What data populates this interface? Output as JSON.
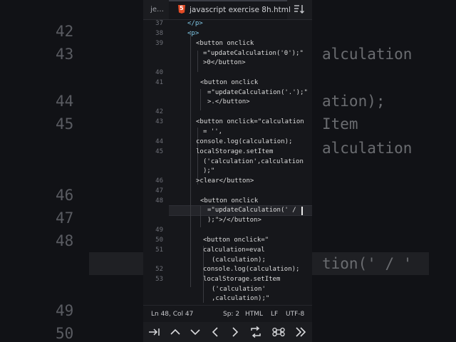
{
  "background": {
    "left_lines": [
      "42",
      "43",
      "44",
      "45",
      "46",
      "47",
      "48",
      "49",
      "50"
    ],
    "right_lines": [
      "alculation",
      "ation);",
      "Item",
      "alculation",
      "tion(' / '"
    ]
  },
  "tabs": {
    "previous_label": "je…",
    "active_label": "javascript exercise 8h.html",
    "file_icon": "html5-icon",
    "sort_icon": "sort-icon"
  },
  "editor": {
    "line_numbers": [
      "37",
      "38",
      "39",
      "",
      "40",
      "41",
      "",
      "42",
      "43",
      "",
      "44",
      "45",
      "",
      "",
      "46",
      "47",
      "48",
      "",
      "49",
      "50",
      "51",
      "",
      "52",
      "53",
      "",
      ""
    ],
    "lines": [
      "</p>",
      "<p>",
      "<button onclick",
      "=\"updateCalculation('0');\"",
      ">0</button>",
      "",
      "<button onclick",
      "=\"updateCalculation('.');\"",
      ">.</button>",
      "",
      "<button onclick=\"calculation",
      "= '',",
      "console.log(calculation);",
      "localStorage.setItem",
      "('calculation',calculation",
      ");\"",
      ">clear</button>",
      "",
      "<button onclick",
      "=\"updateCalculation(' / '",
      ");\">/</button>",
      "",
      "<button onclick=\"",
      "calculation=eval",
      "(calculation);",
      "console.log(calculation);",
      "localStorage.setItem",
      "('calculation'",
      ",calculation);\""
    ]
  },
  "status": {
    "position": "Ln 48, Col 47",
    "indent": "Sp: 2",
    "language": "HTML",
    "eol": "LF",
    "encoding": "UTF-8"
  },
  "keybar": {
    "keys": [
      "tab-icon",
      "arrow-up-icon",
      "arrow-down-icon",
      "arrow-left-icon",
      "arrow-right-icon",
      "swap-icon",
      "command-icon",
      "double-chevron-right-icon"
    ]
  }
}
